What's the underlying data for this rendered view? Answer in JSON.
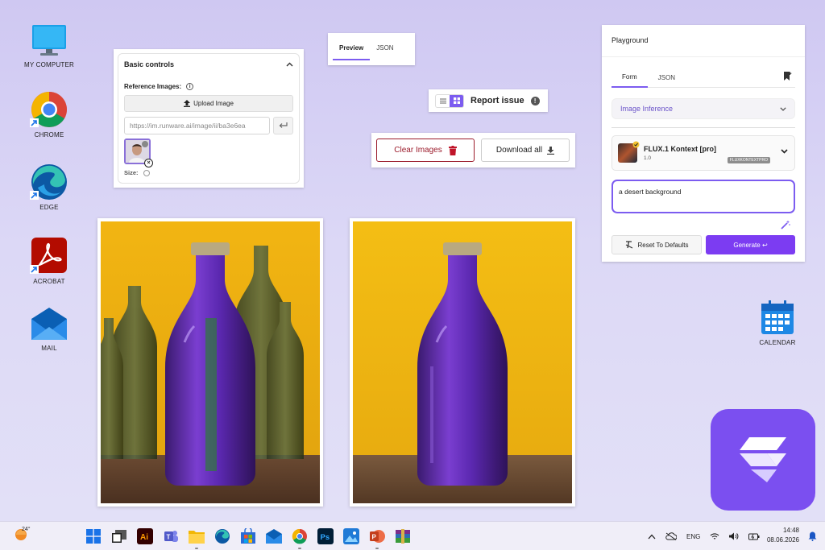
{
  "desktop": {
    "icons": [
      {
        "label": "MY COMPUTER"
      },
      {
        "label": "CHROME"
      },
      {
        "label": "EDGE"
      },
      {
        "label": "ACROBAT"
      },
      {
        "label": "MAIL"
      },
      {
        "label": "CALENDAR"
      }
    ]
  },
  "basic_controls": {
    "title": "Basic controls",
    "reference_label": "Reference Images:",
    "upload_label": "Upload Image",
    "url_value": "https://im.runware.ai/image/ii/ba3e6ea",
    "size_label": "Size:"
  },
  "preview_tabs": {
    "tabs": [
      {
        "label": "Preview"
      },
      {
        "label": "JSON"
      }
    ],
    "active": "Preview"
  },
  "report": {
    "label": "Report issue",
    "warn_glyph": "!"
  },
  "actions": {
    "clear_label": "Clear Images",
    "download_label": "Download all"
  },
  "playground": {
    "title": "Playground",
    "tabs": [
      {
        "label": "Form"
      },
      {
        "label": "JSON"
      }
    ],
    "task_select": "Image Inference",
    "model": {
      "name": "FLUX.1 Kontext [pro]",
      "version": "1.0",
      "tag": "FLUXKONTEXTPRO"
    },
    "prompt": "a desert background",
    "reset_label": "Reset To Defaults",
    "generate_label": "Generate ↩"
  },
  "taskbar": {
    "temperature": "24°",
    "language": "ENG",
    "time": "14:48",
    "date": "08.06.2026"
  },
  "colors": {
    "accent": "#7c5cf0",
    "generate": "#7c3cf2",
    "danger": "#9b1b2b",
    "logo_bg": "#7b4ff0"
  }
}
